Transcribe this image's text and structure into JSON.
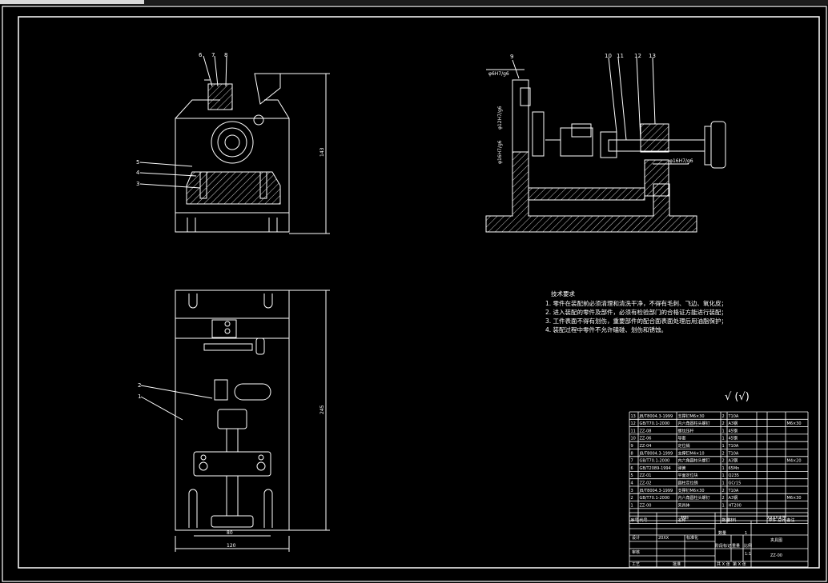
{
  "balloons_side": [
    "6",
    "7",
    "8"
  ],
  "balloons_front_left": [
    "5",
    "4",
    "3"
  ],
  "balloons_plan": [
    "2",
    "1"
  ],
  "balloons_right": [
    "9",
    "10",
    "11",
    "12",
    "13"
  ],
  "fit_labels": [
    "φ6H7/g6",
    "φ12H7/g6",
    "φ16H7/g6",
    "φ16H7/g6"
  ],
  "dims": {
    "height_1": "143",
    "length_1": "245",
    "width_a": "80",
    "width_b": "120"
  },
  "tech": {
    "title": "技术要求",
    "lines": [
      "1. 零件在装配前必须清理和清洗干净，不得有毛刺、飞边、氧化皮；",
      "2. 进入装配的零件及部件，必须有检验部门的合格证方能进行装配；",
      "3. 工件表面不得有划伤，重要部件的配合面表面处理后用油脂保护；",
      "4. 装配过程中零件不允许磕碰、划伤和锈蚀。"
    ]
  },
  "roughness": "√ (√)",
  "bom": {
    "rows": [
      [
        "13",
        "JB/T8004.3-1999",
        "支撑钉M6×30",
        "2",
        "T10A",
        "",
        ""
      ],
      [
        "12",
        "GB/T70.1-2000",
        "内六角圆柱头螺钉",
        "2",
        "A3钢",
        "",
        "M6×30"
      ],
      [
        "11",
        "ZZ-08",
        "螺纹压杆",
        "1",
        "45钢",
        "",
        ""
      ],
      [
        "10",
        "ZZ-06",
        "导套",
        "1",
        "45钢",
        "",
        ""
      ],
      [
        "9",
        "ZZ-04",
        "定位销",
        "1",
        "T10A",
        "",
        ""
      ],
      [
        "8",
        "JB/T8004.3-1999",
        "支撑钉M4×10",
        "2",
        "T10A",
        "",
        ""
      ],
      [
        "7",
        "GB/T70.1-2000",
        "内六角圆柱头螺钉",
        "2",
        "A3钢",
        "",
        "M4×20"
      ],
      [
        "6",
        "GB/T2089-1994",
        "弹簧",
        "1",
        "65Mn",
        "",
        ""
      ],
      [
        "5",
        "ZZ-01",
        "平面定位块",
        "1",
        "Q235",
        "",
        ""
      ],
      [
        "4",
        "ZZ-02",
        "圆柱定位销",
        "1",
        "GCr15",
        "",
        ""
      ],
      [
        "3",
        "JB/T8004.3-1999",
        "支撑钉M6×30",
        "2",
        "T10A",
        "",
        ""
      ],
      [
        "2",
        "GB/T70.1-2000",
        "内六角圆柱头螺钉",
        "2",
        "A3钢",
        "",
        "M6×30"
      ],
      [
        "1",
        "ZZ-00",
        "夹具体",
        "1",
        "HT200",
        "",
        ""
      ]
    ],
    "header": [
      "序号",
      "代号",
      "名称",
      "数量",
      "材料",
      "单件 总计",
      "备注"
    ],
    "mass_header": "重量",
    "title_block": {
      "material": "材料",
      "company": "XXXX大学",
      "drawing_name": "夹具图",
      "drawing_no": "ZZ-00",
      "scale": "1:1",
      "quantity": "1",
      "count_label": "数量",
      "stage": "阶段标记",
      "weight": "重量",
      "ratio": "比例",
      "designer": "设计",
      "reviewer": "审核",
      "process": "工艺",
      "approve": "批准",
      "sheet": "共 X 张",
      "sheet_of": "第 X 张",
      "date_label": "20XX",
      "standard": "标准化"
    }
  },
  "colors": {
    "line": "#ffffff",
    "hatch": "#ffffff",
    "frame": "#ffffff",
    "bg": "#000000",
    "accent_green": "#00ff00"
  }
}
